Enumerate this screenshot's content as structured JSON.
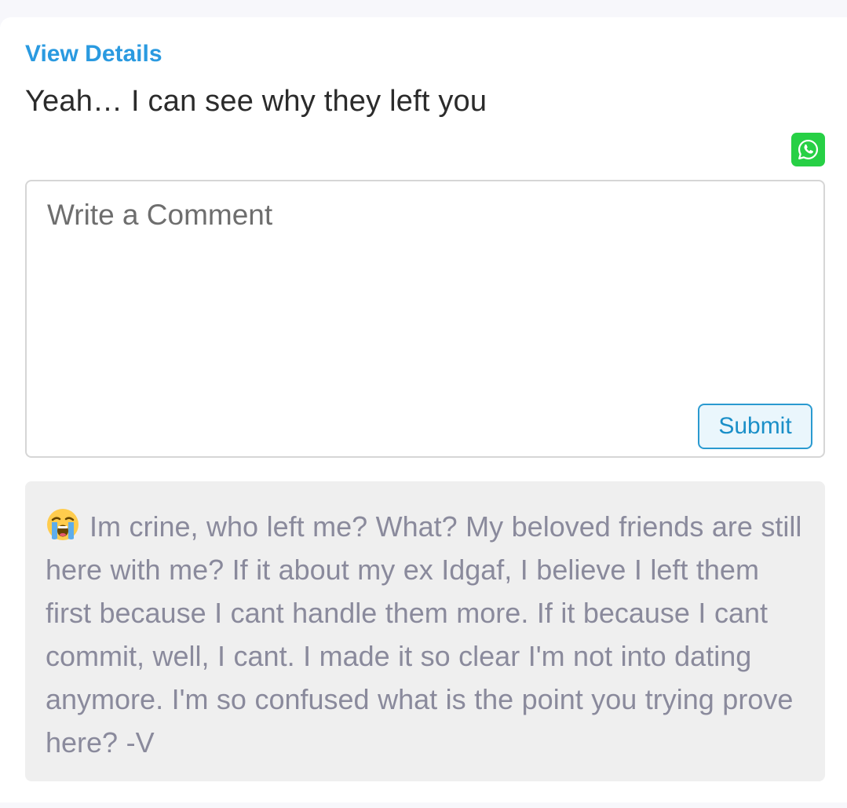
{
  "post": {
    "view_details_label": "View Details",
    "text": "Yeah… I can see why they left you",
    "share_icon": "whatsapp-icon",
    "share_color": "#27d045"
  },
  "comment_form": {
    "placeholder": "Write a Comment",
    "value": "",
    "submit_label": "Submit"
  },
  "reply": {
    "emoji": "loudly-crying-face-emoji",
    "text": "Im crine, who left me? What? My beloved friends are still here with me? If it about my ex Idgaf, I believe I left them first because I cant handle them more. If it because I cant commit, well, I cant. I made it so clear I'm not into dating anymore. I'm so confused what is the point you trying prove here? -V"
  },
  "colors": {
    "accent": "#2a9ae0",
    "reply_text": "#8a8a9c",
    "reply_bg": "#efefef"
  }
}
